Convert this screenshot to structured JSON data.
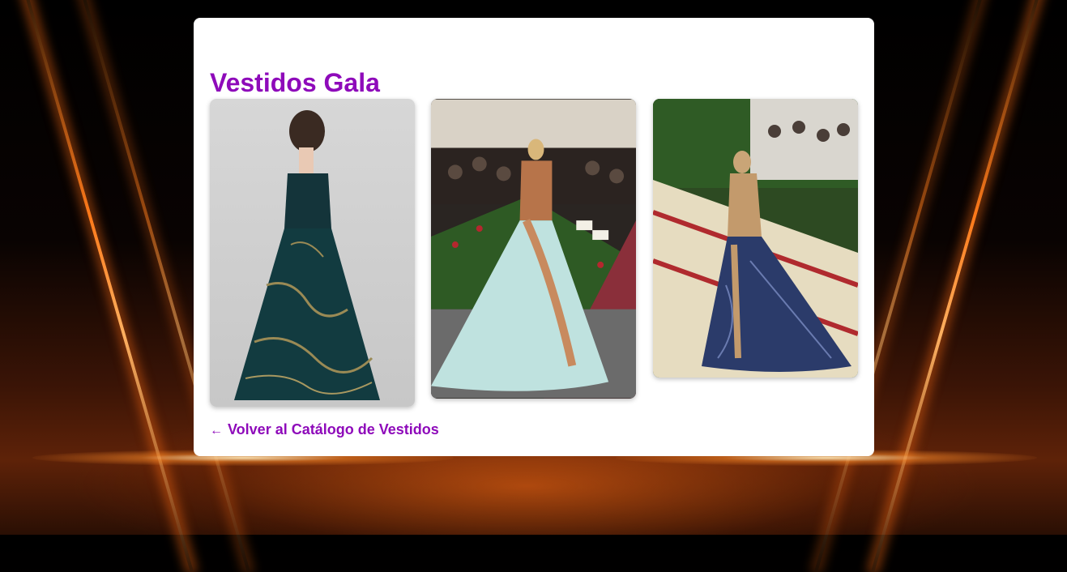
{
  "page": {
    "title": "Vestidos Gala",
    "back_link": {
      "arrow": "←",
      "label": "Volver al Catálogo de Vestidos"
    }
  },
  "gallery": [
    {
      "name": "gown-photo-1",
      "subject": "dark teal jacquard strapless ball gown, back view"
    },
    {
      "name": "gown-photo-2",
      "subject": "copper and pale blue gown on red-carpet stairs"
    },
    {
      "name": "gown-photo-3",
      "subject": "sequined sheer gown with navy train on carpeted stairs"
    }
  ],
  "colors": {
    "accent": "#8e0aba",
    "card": "#ffffff",
    "background": "#000000",
    "glow": "#ff7a1a"
  }
}
